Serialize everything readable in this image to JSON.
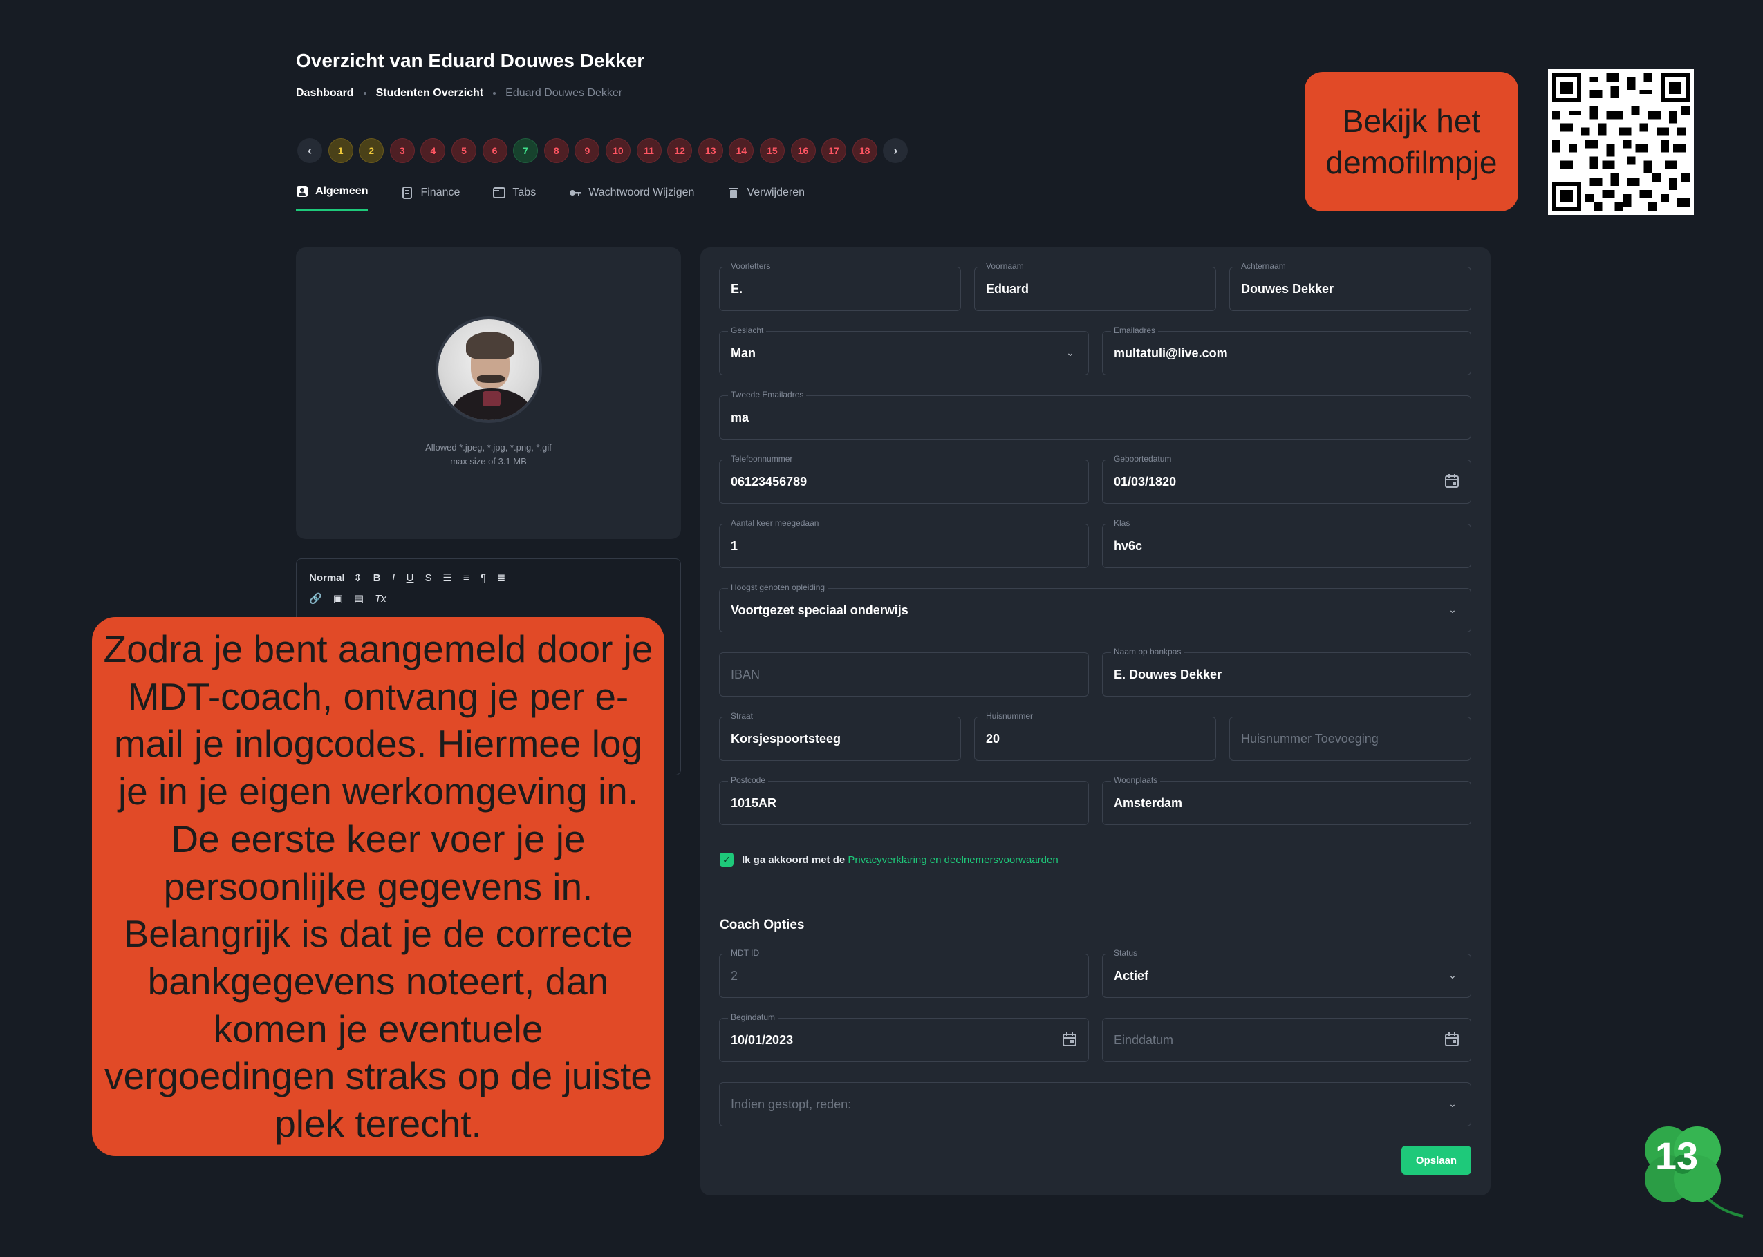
{
  "header": {
    "title": "Overzicht van Eduard Douwes Dekker",
    "breadcrumb": [
      "Dashboard",
      "Studenten Overzicht",
      "Eduard Douwes Dekker"
    ]
  },
  "pagination": {
    "pages": [
      {
        "label": "1",
        "status": "yellow"
      },
      {
        "label": "2",
        "status": "yellow"
      },
      {
        "label": "3",
        "status": "red"
      },
      {
        "label": "4",
        "status": "red"
      },
      {
        "label": "5",
        "status": "red"
      },
      {
        "label": "6",
        "status": "red"
      },
      {
        "label": "7",
        "status": "green"
      },
      {
        "label": "8",
        "status": "red"
      },
      {
        "label": "9",
        "status": "red"
      },
      {
        "label": "10",
        "status": "red"
      },
      {
        "label": "11",
        "status": "red"
      },
      {
        "label": "12",
        "status": "red"
      },
      {
        "label": "13",
        "status": "red"
      },
      {
        "label": "14",
        "status": "red"
      },
      {
        "label": "15",
        "status": "red"
      },
      {
        "label": "16",
        "status": "red"
      },
      {
        "label": "17",
        "status": "red"
      },
      {
        "label": "18",
        "status": "red"
      }
    ]
  },
  "tabs": [
    {
      "label": "Algemeen",
      "icon": "user-card-icon",
      "active": true
    },
    {
      "label": "Finance",
      "icon": "document-icon",
      "active": false
    },
    {
      "label": "Tabs",
      "icon": "window-icon",
      "active": false
    },
    {
      "label": "Wachtwoord Wijzigen",
      "icon": "key-icon",
      "active": false
    },
    {
      "label": "Verwijderen",
      "icon": "trash-icon",
      "active": false
    }
  ],
  "avatar": {
    "allowed_line1": "Allowed *.jpeg, *.jpg, *.png, *.gif",
    "allowed_line2": "max size of 3.1 MB"
  },
  "editor": {
    "style_select": "Normal"
  },
  "form": {
    "voorletters": {
      "label": "Voorletters",
      "value": "E."
    },
    "voornaam": {
      "label": "Voornaam",
      "value": "Eduard"
    },
    "achternaam": {
      "label": "Achternaam",
      "value": "Douwes Dekker"
    },
    "geslacht": {
      "label": "Geslacht",
      "value": "Man"
    },
    "emailadres": {
      "label": "Emailadres",
      "value": "multatuli@live.com"
    },
    "tweede_emailadres": {
      "label": "Tweede Emailadres",
      "value": "ma"
    },
    "telefoonnummer": {
      "label": "Telefoonnummer",
      "value": "06123456789"
    },
    "geboortedatum": {
      "label": "Geboortedatum",
      "value": "01/03/1820"
    },
    "aantal_keer": {
      "label": "Aantal keer meegedaan",
      "value": "1"
    },
    "klas": {
      "label": "Klas",
      "value": "hv6c"
    },
    "opleiding": {
      "label": "Hoogst genoten opleiding",
      "value": "Voortgezet speciaal onderwijs"
    },
    "iban": {
      "placeholder": "IBAN"
    },
    "naam_bank": {
      "label": "Naam op bankpas",
      "value": "E. Douwes Dekker"
    },
    "straat": {
      "label": "Straat",
      "value": "Korsjespoortsteeg"
    },
    "huisnummer": {
      "label": "Huisnummer",
      "value": "20"
    },
    "toevoeging": {
      "placeholder": "Huisnummer Toevoeging"
    },
    "postcode": {
      "label": "Postcode",
      "value": "1015AR"
    },
    "woonplaats": {
      "label": "Woonplaats",
      "value": "Amsterdam"
    },
    "consent_text": "Ik ga akkoord met de",
    "consent_link": "Privacyverklaring en deelnemersvoorwaarden",
    "coach_title": "Coach Opties",
    "mdt_id": {
      "label": "MDT ID",
      "value": "2"
    },
    "status": {
      "label": "Status",
      "value": "Actief"
    },
    "begindatum": {
      "label": "Begindatum",
      "value": "10/01/2023"
    },
    "einddatum": {
      "placeholder": "Einddatum"
    },
    "reden": {
      "placeholder": "Indien gestopt, reden:"
    },
    "save_label": "Opslaan"
  },
  "overlay": {
    "callout_text": "Zodra je bent aangemeld door je MDT-coach, ontvang je per e-mail je inlogcodes. Hiermee log je in je eigen werkomgeving in. De eerste keer voer je je persoonlijke gegevens in. Belangrijk is dat je de correcte bankgegevens noteert, dan komen je eventuele vergoedingen straks op de juiste plek terecht.",
    "demo_label": "Bekijk het demofilmpje",
    "page_number": "13"
  },
  "colors": {
    "background": "#171c24",
    "card": "#222831",
    "accent_green": "#1ec97a",
    "overlay_orange": "#e14a27"
  }
}
